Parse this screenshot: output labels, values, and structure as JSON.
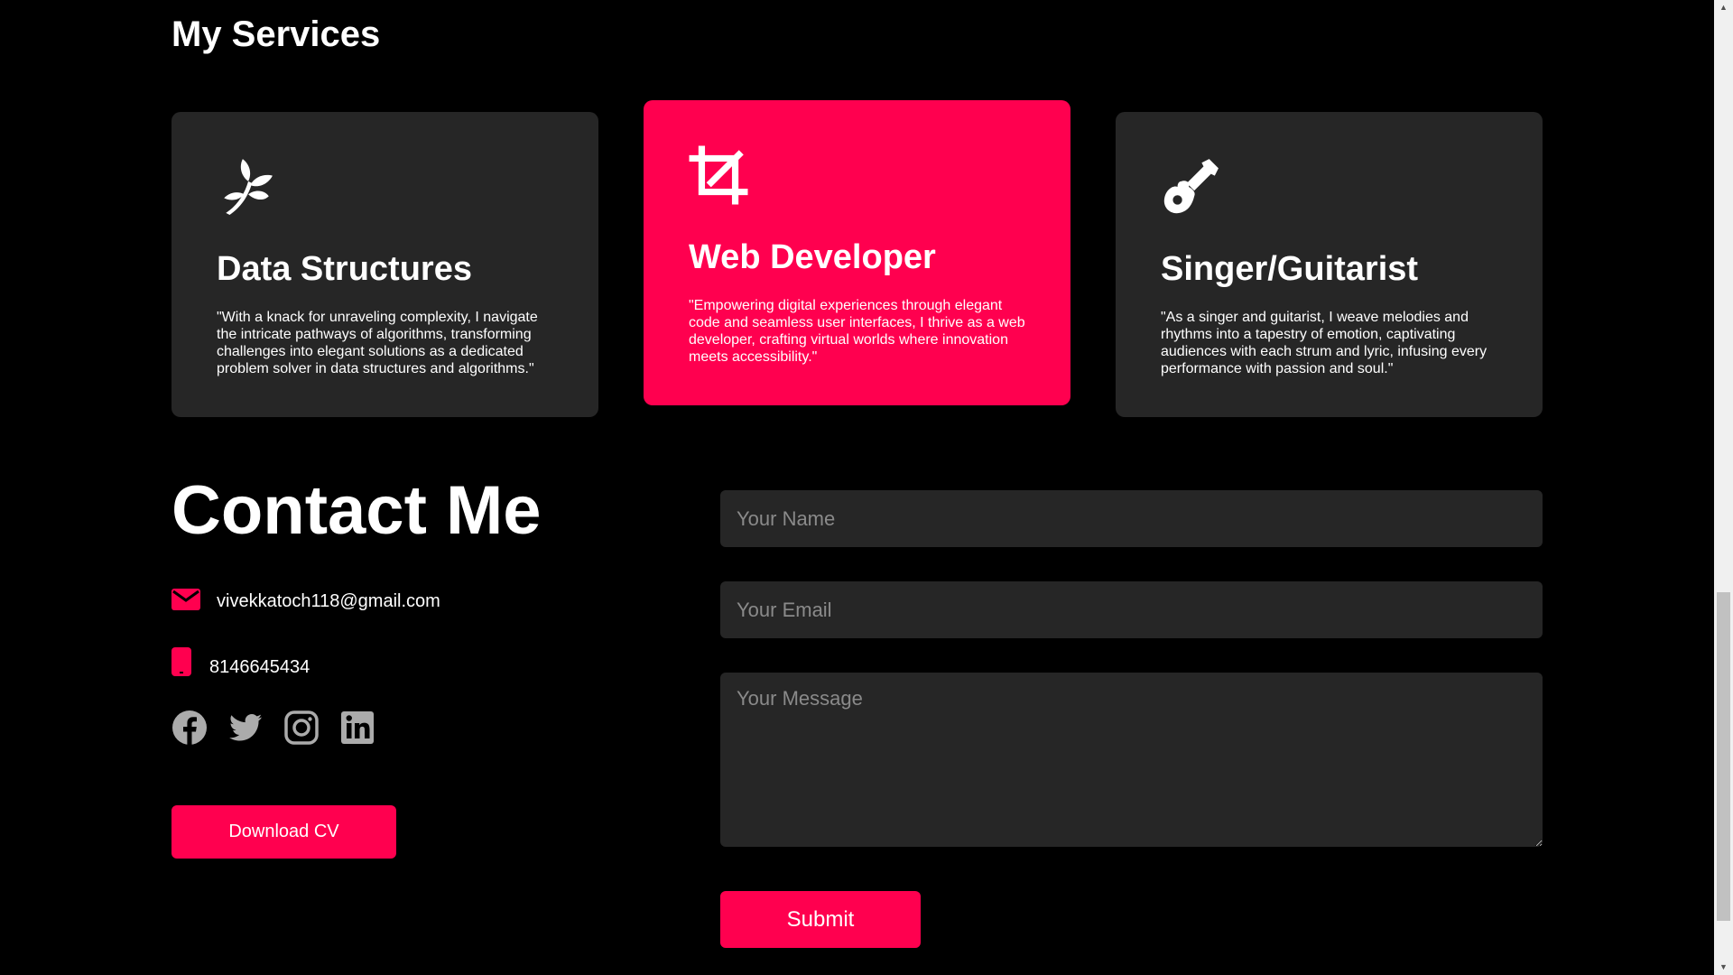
{
  "services": {
    "heading": "My Services",
    "cards": [
      {
        "icon": "leaf-sprout-icon",
        "title": "Data Structures",
        "text": "\"With a knack for unraveling complexity, I navigate the intricate pathways of algorithms, transforming challenges into elegant solutions as a dedicated problem solver in data structures and algorithms.\""
      },
      {
        "icon": "crop-icon",
        "title": "Web Developer",
        "text": "\"Empowering digital experiences through elegant code and seamless user interfaces, I thrive as a web developer, crafting virtual worlds where innovation meets accessibility.\""
      },
      {
        "icon": "guitar-icon",
        "title": "Singer/Guitarist",
        "text": "\"As a singer and guitarist, I weave melodies and rhythms into a tapestry of emotion, captivating audiences with each strum and lyric, infusing every performance with passion and soul.\""
      }
    ]
  },
  "contact": {
    "heading": "Contact Me",
    "email": "vivekkatoch118@gmail.com",
    "phone": "8146645434",
    "socials": [
      "facebook-icon",
      "twitter-icon",
      "instagram-icon",
      "linkedin-icon"
    ],
    "download_cv_label": "Download CV"
  },
  "form": {
    "name_placeholder": "Your Name",
    "email_placeholder": "Your Email",
    "message_placeholder": "Your Message",
    "submit_label": "Submit"
  },
  "colors": {
    "accent": "#ff004f",
    "background": "#000000",
    "card": "#262626",
    "social_icon": "#ababab"
  }
}
